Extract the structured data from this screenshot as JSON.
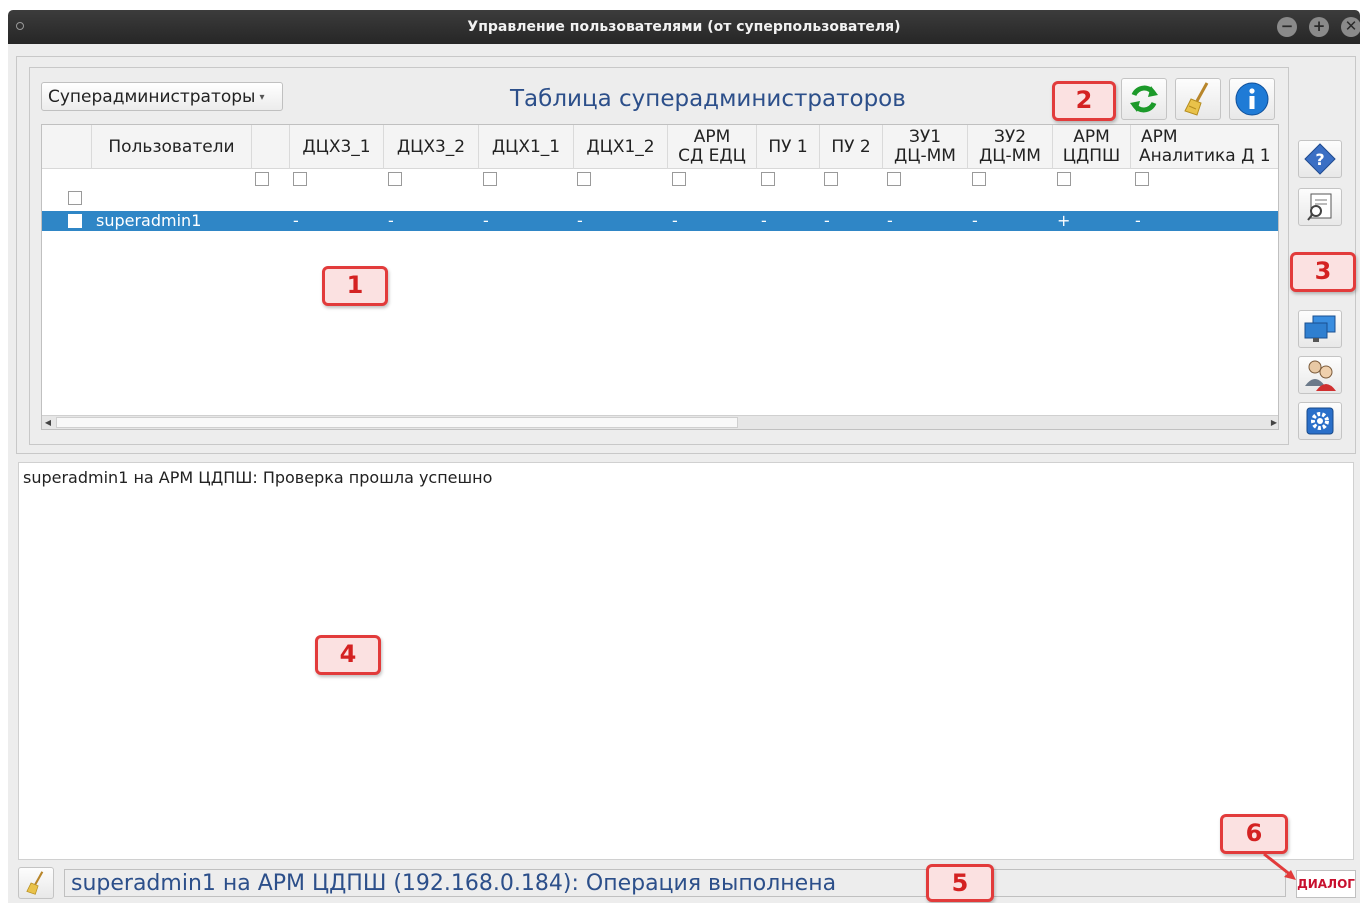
{
  "window": {
    "title": "Управление пользователями (от суперпользователя)",
    "min_glyph": "−",
    "max_glyph": "+",
    "close_glyph": "✕"
  },
  "toolbar": {
    "group_select": "Суперадминистраторы",
    "table_title": "Таблица суперадминистраторов",
    "icons": [
      "refresh-icon",
      "broom-icon",
      "info-icon"
    ]
  },
  "table": {
    "headers": [
      "Пользователи",
      "ДЦХ3_1",
      "ДЦХ3_2",
      "ДЦХ1_1",
      "ДЦХ1_2",
      "АРМ СД ЕДЦ",
      "ПУ 1",
      "ПУ 2",
      "ЗУ1 ДЦ-ММ",
      "ЗУ2 ДЦ-ММ",
      "АРМ ЦДПШ",
      "АРМ Аналитика Д 1"
    ],
    "header_lines": [
      [
        "Пользователи"
      ],
      [
        "ДЦХ3_1"
      ],
      [
        "ДЦХ3_2"
      ],
      [
        "ДЦХ1_1"
      ],
      [
        "ДЦХ1_2"
      ],
      [
        "АРМ",
        "СД ЕДЦ"
      ],
      [
        "ПУ 1"
      ],
      [
        "ПУ 2"
      ],
      [
        "ЗУ1",
        "ДЦ-ММ"
      ],
      [
        "ЗУ2",
        "ДЦ-ММ"
      ],
      [
        "АРМ",
        "ЦДПШ"
      ],
      [
        "АРМ",
        "Аналитика Д 1"
      ]
    ],
    "rows": [
      {
        "user": "superadmin1",
        "values": [
          "-",
          "-",
          "-",
          "-",
          "-",
          "-",
          "-",
          "-",
          "-",
          "+",
          "-"
        ],
        "selected": true
      }
    ]
  },
  "side_icons": [
    "help-diamond-icon",
    "report-icon",
    "monitors-icon",
    "users-icon",
    "settings-icon"
  ],
  "log": {
    "lines": [
      "superadmin1 на АРМ ЦДПШ: Проверка прошла успешно"
    ]
  },
  "status": {
    "text": "superadmin1 на АРМ ЦДПШ (192.168.0.184): Операция выполнена",
    "dialog_label": "ДИАЛОГ"
  },
  "callouts": [
    "1",
    "2",
    "3",
    "4",
    "5",
    "6"
  ],
  "colors": {
    "accent_blue": "#2c4f8a",
    "selection": "#2f86c6",
    "callout_red": "#e23b3b"
  }
}
